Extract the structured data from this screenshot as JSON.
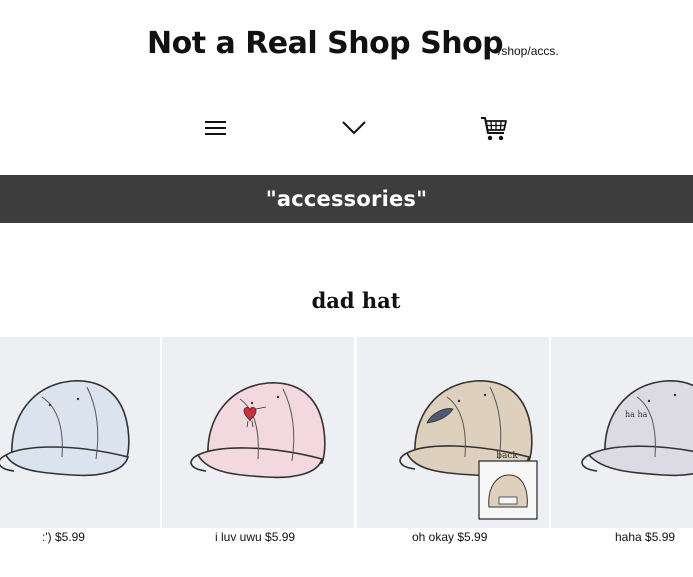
{
  "header": {
    "title": "Not a Real Shop Shop",
    "breadcrumb": "/shop/accs.",
    "nav": {
      "menu_icon": "hamburger-menu-icon",
      "dropdown_icon": "chevron-down-icon",
      "cart_icon": "shopping-cart-icon"
    }
  },
  "banner": {
    "title": "\"accessories\""
  },
  "section": {
    "title": "dad hat"
  },
  "products": [
    {
      "caption": ":') $5.99",
      "cap_color": "#dbe4ee",
      "emblem": ""
    },
    {
      "caption": "i luv uwu $5.99",
      "cap_color": "#f3d9df",
      "emblem": "heart"
    },
    {
      "caption": "oh okay $5.99",
      "cap_color": "#ddd1bd",
      "emblem": "whale",
      "back_label": "back"
    },
    {
      "caption": "haha $5.99",
      "cap_color": "#dcdae3",
      "emblem_text": "ha ha"
    }
  ],
  "colors": {
    "banner_bg": "#3d3d3d",
    "product_bg": "#eeeff2"
  }
}
